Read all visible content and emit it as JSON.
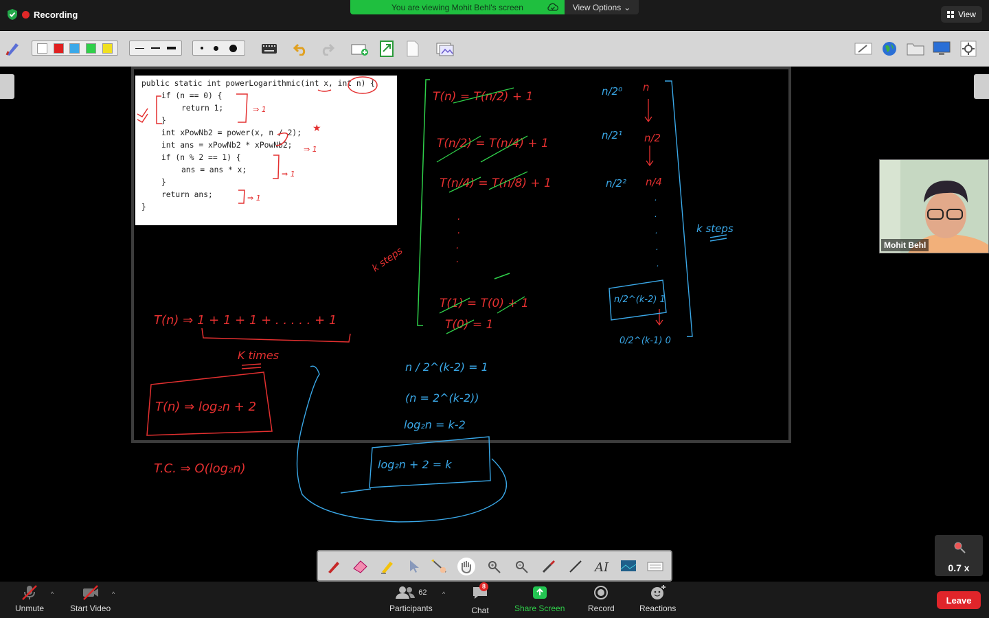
{
  "topbar": {
    "recording_label": "Recording",
    "banner_text": "You are viewing Mohit Behl's screen",
    "view_options_label": "View Options",
    "view_button_label": "View"
  },
  "annotation_toolbar": {
    "colors": [
      "#ffffff",
      "#e02020",
      "#3aa8e8",
      "#2fd04a",
      "#f0e020"
    ],
    "line_widths": [
      "thin",
      "medium",
      "thick"
    ],
    "dot_sizes": [
      "small",
      "medium",
      "large"
    ],
    "tools_left": [
      "pen-settings-icon",
      "keyboard-icon",
      "undo-icon",
      "redo-icon",
      "add-page-icon",
      "export-page-icon",
      "page-icon",
      "gallery-icon"
    ],
    "tools_right": [
      "edit-icon",
      "globe-icon",
      "folder-icon",
      "monitor-icon",
      "settings-icon"
    ]
  },
  "code": {
    "lines": [
      {
        "indent": 0,
        "text": "public static int powerLogarithmic(int x, int n) {"
      },
      {
        "indent": 1,
        "text": "if (n == 0) {"
      },
      {
        "indent": 2,
        "text": "return 1;"
      },
      {
        "indent": 1,
        "text": "}"
      },
      {
        "indent": 1,
        "text": "int xPowNb2 = power(x, n / 2);"
      },
      {
        "indent": 1,
        "text": "int ans = xPowNb2 * xPowNb2;"
      },
      {
        "indent": 1,
        "text": "if (n % 2 == 1) {"
      },
      {
        "indent": 2,
        "text": "ans = ans * x;"
      },
      {
        "indent": 1,
        "text": "}"
      },
      {
        "indent": 1,
        "text": "return ans;"
      },
      {
        "indent": 0,
        "text": "}"
      }
    ]
  },
  "handwriting": {
    "recur1": "T(n) = T(n/2) + 1",
    "recur2": "T(n/2) = T(n/4) + 1",
    "recur3": "T(n/4) = T(n/8) + 1",
    "recur_last1": "T(1) = T(0) + 1",
    "recur_last2": "T(0) = 1",
    "k_steps_left": "k steps",
    "k_steps_right": "k steps",
    "col_a": [
      "n/2⁰",
      "n/2¹",
      "n/2²"
    ],
    "col_b": [
      "n",
      "n/2",
      "n/4"
    ],
    "box_right": "n/2^(k-2) 1",
    "below_box": "0/2^(k-1)  0",
    "sum_line": "T(n) ⇒ 1 + 1 + 1 + . . . . . + 1",
    "ktimes": "K times",
    "result_box": "T(n) ⇒ log₂n + 2",
    "tc": "T.C. ⇒ O(log₂n)",
    "mid1": "n / 2^(k-2) = 1",
    "mid2": "(n = 2^(k-2))",
    "mid3": "log₂n = k-2",
    "mid_box": "log₂n + 2 = k"
  },
  "video": {
    "name": "Mohit Behl"
  },
  "zoom": {
    "value": "0.7 x"
  },
  "dock": {
    "tools": [
      "pen-icon",
      "eraser-icon",
      "highlighter-icon",
      "pointer-icon",
      "magic-wand-icon",
      "hand-icon",
      "zoom-in-icon",
      "zoom-out-icon",
      "brush-icon",
      "line-icon",
      "text-icon",
      "image-icon",
      "keyboard-icon"
    ]
  },
  "bottombar": {
    "unmute": "Unmute",
    "start_video": "Start Video",
    "participants": "Participants",
    "participant_count": "62",
    "chat": "Chat",
    "chat_badge": "8",
    "share_screen": "Share Screen",
    "record": "Record",
    "reactions": "Reactions",
    "leave": "Leave"
  }
}
